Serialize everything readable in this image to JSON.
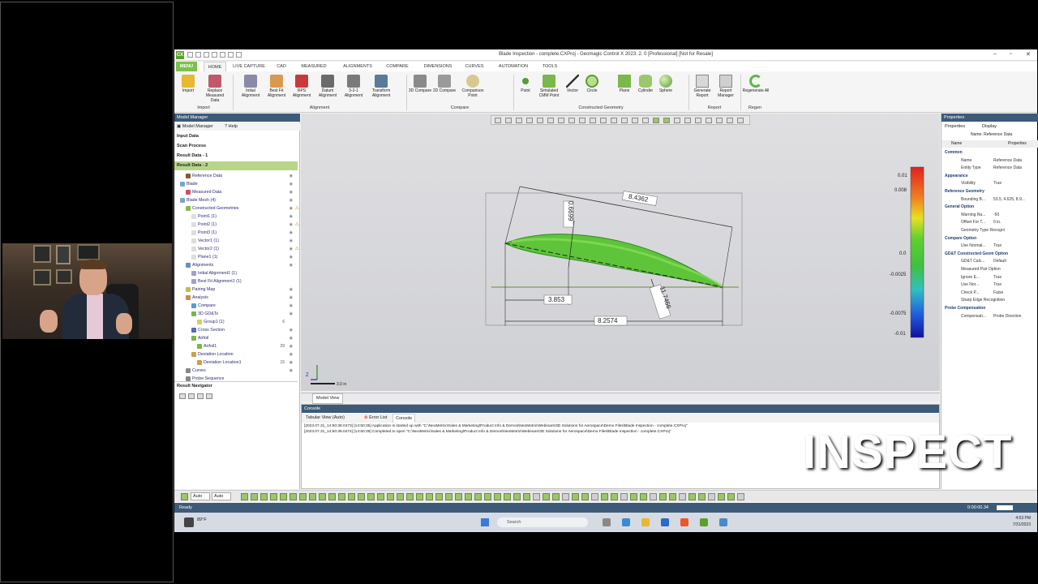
{
  "window": {
    "title": "Blade Inspection - complete.CXProj - Geomagic Control X 2023. 2. 0 [Professional] [Not for Resale]",
    "logo": "CX"
  },
  "menu_tabs": [
    "MENU",
    "HOME",
    "LIVE CAPTURE",
    "CAD",
    "MEASURED",
    "ALIGNMENTS",
    "COMPARE",
    "DIMENSIONS",
    "CURVES",
    "AUTOMATION",
    "TOOLS"
  ],
  "ribbon": {
    "buttons": [
      {
        "label": "Import",
        "icon": "import-icon"
      },
      {
        "label": "Replace Measured Data",
        "icon": "replace-data-icon"
      },
      {
        "label": "Initial Alignment",
        "icon": "initial-alignment-icon"
      },
      {
        "label": "Best Fit Alignment",
        "icon": "best-fit-icon"
      },
      {
        "label": "RPS Alignment",
        "icon": "rps-icon"
      },
      {
        "label": "Datum Alignment",
        "icon": "datum-icon"
      },
      {
        "label": "3-2-1 Alignment",
        "icon": "three-two-one-icon"
      },
      {
        "label": "Transform Alignment",
        "icon": "transform-icon"
      },
      {
        "label": "3D Compare",
        "icon": "3d-compare-icon"
      },
      {
        "label": "2D Compare",
        "icon": "2d-compare-icon"
      },
      {
        "label": "Comparison Point",
        "icon": "comparison-point-icon"
      },
      {
        "label": "Point",
        "icon": "point-icon"
      },
      {
        "label": "Simulated CMM Point",
        "icon": "cmm-point-icon"
      },
      {
        "label": "Vector",
        "icon": "vector-icon"
      },
      {
        "label": "Circle",
        "icon": "circle-icon"
      },
      {
        "label": "Plane",
        "icon": "plane-icon"
      },
      {
        "label": "Cylinder",
        "icon": "cylinder-icon"
      },
      {
        "label": "Sphere",
        "icon": "sphere-icon"
      },
      {
        "label": "Generate Report",
        "icon": "generate-report-icon"
      },
      {
        "label": "Report Manager",
        "icon": "report-manager-icon"
      },
      {
        "label": "Regenerate All",
        "icon": "regenerate-icon"
      }
    ],
    "groups": [
      "Import",
      "Alignment",
      "Compare",
      "Constructed Geometry",
      "Report",
      "Regen"
    ]
  },
  "model_manager": {
    "title": "Model Manager",
    "tabs": [
      "Model Manager",
      "Help"
    ],
    "sections": [
      "Input Data",
      "Scan Process",
      "Result Data - 1",
      "Result Data - 2"
    ],
    "tree": [
      {
        "label": "Reference Data",
        "color": "#8a5a2a"
      },
      {
        "label": "Blade",
        "color": "#7aa8c8"
      },
      {
        "label": "Measured Data",
        "color": "#c8506a"
      },
      {
        "label": "Blade Mesh (4)",
        "color": "#7aa8c8"
      },
      {
        "label": "Constructed Geometries",
        "color": "#8ab84a"
      },
      {
        "label": "Point1 (1)",
        "color": "#dddddd"
      },
      {
        "label": "Point2 (1)",
        "color": "#dddddd"
      },
      {
        "label": "Point3 (1)",
        "color": "#dddddd"
      },
      {
        "label": "Vector1 (1)",
        "color": "#dddddd"
      },
      {
        "label": "Vector2 (1)",
        "color": "#dddddd"
      },
      {
        "label": "Plane1 (1)",
        "color": "#dddddd"
      },
      {
        "label": "Alignments",
        "color": "#6a8ac8"
      },
      {
        "label": "Initial Alignment1 (1)",
        "color": "#a0a0d0"
      },
      {
        "label": "Best Fit Alignment1 (1)",
        "color": "#a0a0d0"
      },
      {
        "label": "Pairing Map",
        "color": "#c0c040"
      },
      {
        "label": "Analysis",
        "color": "#c89040"
      },
      {
        "label": "Compare",
        "color": "#5a9ad8"
      },
      {
        "label": "3D GD&Ts",
        "color": "#7ab84a"
      },
      {
        "label": "Group1 (1)",
        "color": "#d0d060"
      },
      {
        "label": "Cross Section",
        "color": "#5a6ab8"
      },
      {
        "label": "Airfoil",
        "color": "#7ab84a"
      },
      {
        "label": "Airfoil1",
        "color": "#7ab84a"
      },
      {
        "label": "Deviation Location",
        "color": "#c8a050"
      },
      {
        "label": "Deviation Location1",
        "color": "#c8a050"
      },
      {
        "label": "Curves",
        "color": "#888888"
      },
      {
        "label": "Probe Sequence",
        "color": "#888888"
      }
    ],
    "counts": {
      "group1": "6",
      "airfoil1": "29",
      "devloc1": "15"
    },
    "result_navigator": "Result Navigator"
  },
  "viewport": {
    "dimensions": [
      "8.4362",
      "0.6699",
      "3.853",
      "11.7466",
      "8.2574"
    ],
    "colorbar_labels": [
      "0.01",
      "0.008",
      "0.0",
      "-0.0025",
      "-0.0075",
      "-0.01"
    ],
    "scale_label": "3.0 in",
    "axis_label": "Z"
  },
  "model_view_tab": "Model View",
  "console": {
    "title": "Console",
    "tabs": [
      "Tabular View (Auto)",
      "Error List",
      "Console"
    ],
    "lines": [
      "[2023.07.31_14:50:39.0473] [14:50:35] Application is started up with \"C:\\NeoMetrix\\Sales & Marketing\\Product Info & Demos\\NeoMetrix\\Webinars\\3D Solutions for Aerospace\\Demo Files\\Blade Inspection - complete.CXProj\"",
      "[2023.07.31_14:50:39.0474] [14:50:39] Completed to open \"C:\\NeoMetrix\\Sales & Marketing\\Product Info & Demos\\NeoMetrix\\Webinars\\3D Solutions for Aerospace\\Demo Files\\Blade Inspection - complete.CXProj\""
    ]
  },
  "properties": {
    "title": "Properties",
    "tabs": [
      "Properties",
      "Display"
    ],
    "name_field": "Name: Reference Data",
    "columns": [
      "Name",
      "Properties"
    ],
    "rows": [
      {
        "k": "Common",
        "cat": true
      },
      {
        "k": "Name",
        "v": "Reference Data"
      },
      {
        "k": "Entity Type",
        "v": "Reference Data"
      },
      {
        "k": "Appearance",
        "cat": true
      },
      {
        "k": "Visibility",
        "v": "True"
      },
      {
        "k": "Reference Geometry",
        "cat": true
      },
      {
        "k": "Bounding B...",
        "v": "53.5, 4.625, 8.9..."
      },
      {
        "k": "General Option",
        "cat": true
      },
      {
        "k": "Warning Ra...",
        "v": "-50"
      },
      {
        "k": "Offset For T...",
        "v": "0 in."
      },
      {
        "k": "Geometry Type Recognition",
        "v": ""
      },
      {
        "k": "Compare Option",
        "cat": true
      },
      {
        "k": "Use Normal...",
        "v": "True"
      },
      {
        "k": "GD&T Constructed Geom Option",
        "cat": true
      },
      {
        "k": "GD&T Calc...",
        "v": "Default"
      },
      {
        "k": "Measured Pair Option",
        "v": ""
      },
      {
        "k": "Ignore E...",
        "v": "True"
      },
      {
        "k": "Use Nor...",
        "v": "True"
      },
      {
        "k": "Check P...",
        "v": "False"
      },
      {
        "k": "Sharp Edge Recognition",
        "v": ""
      },
      {
        "k": "Probe Compensation",
        "cat": true
      },
      {
        "k": "Compensati...",
        "v": "Probe Direction"
      }
    ]
  },
  "bottom_toolbar": {
    "auto1": "Auto",
    "auto2": "Auto"
  },
  "status": {
    "text": "Ready",
    "timer": "0:00:00.34"
  },
  "taskbar": {
    "search_placeholder": "Search",
    "time": "4:53 PM",
    "date": "7/31/2023",
    "weather": "89°F"
  },
  "overlay_text": "INSPECT",
  "colors": {
    "accent": "#7cc24a",
    "panel_header": "#3d5a78"
  }
}
